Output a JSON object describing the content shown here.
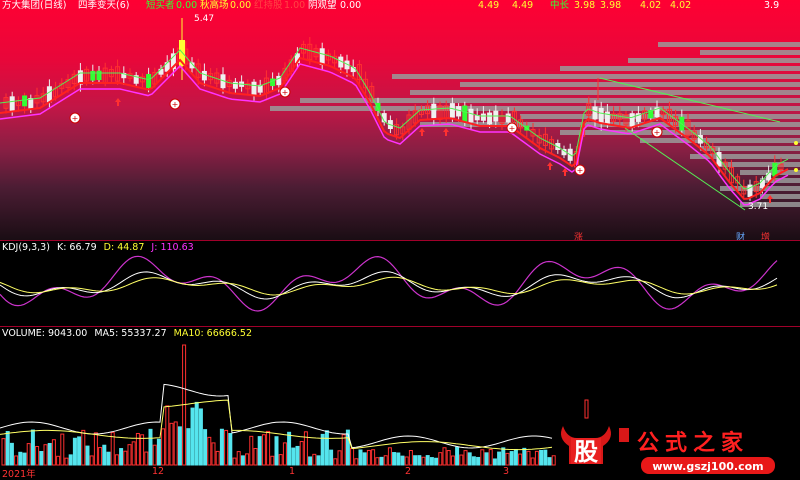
{
  "header": {
    "app_title": "方大集团(日线)",
    "indicator": "四季变天(6)",
    "items": [
      {
        "label": "短买者",
        "value": "0.00"
      },
      {
        "label": "秋高场",
        "value": "0.00"
      },
      {
        "label": "红持股",
        "value": "1.00"
      },
      {
        "label": "阴观望",
        "value": "0.00"
      }
    ],
    "right_values": [
      "4.49",
      "4.49"
    ],
    "mid_label": "中长",
    "mid_values": [
      "3.98",
      "3.98"
    ],
    "right_values2": [
      "4.02",
      "4.02"
    ],
    "corner": "3.9"
  },
  "price_labels": {
    "high": "5.47",
    "low": "3.71"
  },
  "markers": {
    "rise": "涨",
    "cai": "财",
    "zeng": "增"
  },
  "kdj": {
    "title": "KDJ(9,3,3)",
    "k": "K: 66.79",
    "d": "D: 44.87",
    "j": "J: 110.63"
  },
  "volume": {
    "title": "VOLUME: 9043.00",
    "ma5": "MA5: 55337.27",
    "ma10": "MA10: 66666.52"
  },
  "dates": [
    "2021年",
    "12",
    "1",
    "2",
    "3"
  ],
  "watermark": {
    "brand": "股",
    "site": "公式之家",
    "url": "www.gszj100.com"
  },
  "colors": {
    "up": "#ff3030",
    "down": "#ffffff",
    "green": "#33ff33",
    "magenta": "#ff33ff",
    "accent": "#ffff33"
  }
}
